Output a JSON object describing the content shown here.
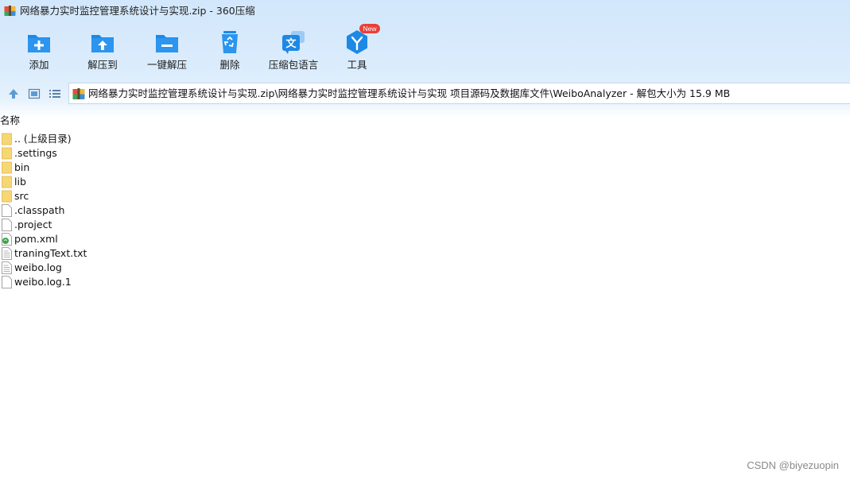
{
  "window": {
    "title": "网络暴力实时监控管理系统设计与实现.zip - 360压缩",
    "app_icon": "archive-app-icon"
  },
  "toolbar": {
    "items": [
      {
        "label": "添加",
        "icon": "add-icon"
      },
      {
        "label": "解压到",
        "icon": "extract-to-icon"
      },
      {
        "label": "一键解压",
        "icon": "one-click-extract-icon"
      },
      {
        "label": "删除",
        "icon": "delete-recycle-icon"
      },
      {
        "label": "压缩包语言",
        "icon": "archive-language-icon"
      },
      {
        "label": "工具",
        "icon": "tools-icon"
      }
    ],
    "new_badge": "New"
  },
  "nav": {
    "up_icon": "up-arrow-icon",
    "view_icon": "thumbnail-view-icon",
    "list_icon": "list-view-icon"
  },
  "address": {
    "path": "网络暴力实时监控管理系统设计与实现.zip\\网络暴力实时监控管理系统设计与实现 项目源码及数据库文件\\WeiboAnalyzer - 解包大小为 15.9 MB"
  },
  "file_list": {
    "column_header": "名称",
    "rows": [
      {
        "name": ".. (上级目录)",
        "type": "folder"
      },
      {
        "name": ".settings",
        "type": "folder"
      },
      {
        "name": "bin",
        "type": "folder"
      },
      {
        "name": "lib",
        "type": "folder"
      },
      {
        "name": "src",
        "type": "folder"
      },
      {
        "name": ".classpath",
        "type": "file"
      },
      {
        "name": ".project",
        "type": "file"
      },
      {
        "name": "pom.xml",
        "type": "xml"
      },
      {
        "name": "traningText.txt",
        "type": "text"
      },
      {
        "name": "weibo.log",
        "type": "text"
      },
      {
        "name": "weibo.log.1",
        "type": "file"
      }
    ]
  },
  "watermark": "CSDN @biyezuopin",
  "colors": {
    "accent_blue": "#1e88e5",
    "header_bg": "#d2e7fb",
    "folder_yellow": "#f7d774",
    "badge_red": "#e8403a"
  }
}
